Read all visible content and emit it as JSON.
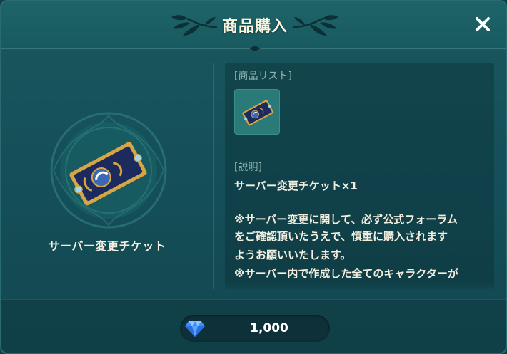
{
  "dialog": {
    "title": "商品購入",
    "close_icon": "close-icon"
  },
  "product": {
    "name": "サーバー変更チケット",
    "icon": "ticket-icon"
  },
  "details": {
    "list_label": "[商品リスト]",
    "description_label": "[説明]",
    "lines": [
      "サーバー変更チケット×1",
      "",
      "※サーバー変更に関して、必ず公式フォーラム",
      "をご確認頂いたうえで、慎重に購入されます",
      "ようお願いいたします。",
      "※サーバー内で作成した全てのキャラクターが"
    ]
  },
  "purchase": {
    "currency_icon": "diamond-icon",
    "price": "1,000"
  },
  "colors": {
    "background": "#15505a",
    "title_text": "#fbf5df",
    "label_text": "#8fb5b2",
    "tile": "#2a7a7a",
    "ticket_navy": "#1c2a5e",
    "ticket_gold": "#d6a645",
    "gem_blue": "#3e8cff"
  }
}
